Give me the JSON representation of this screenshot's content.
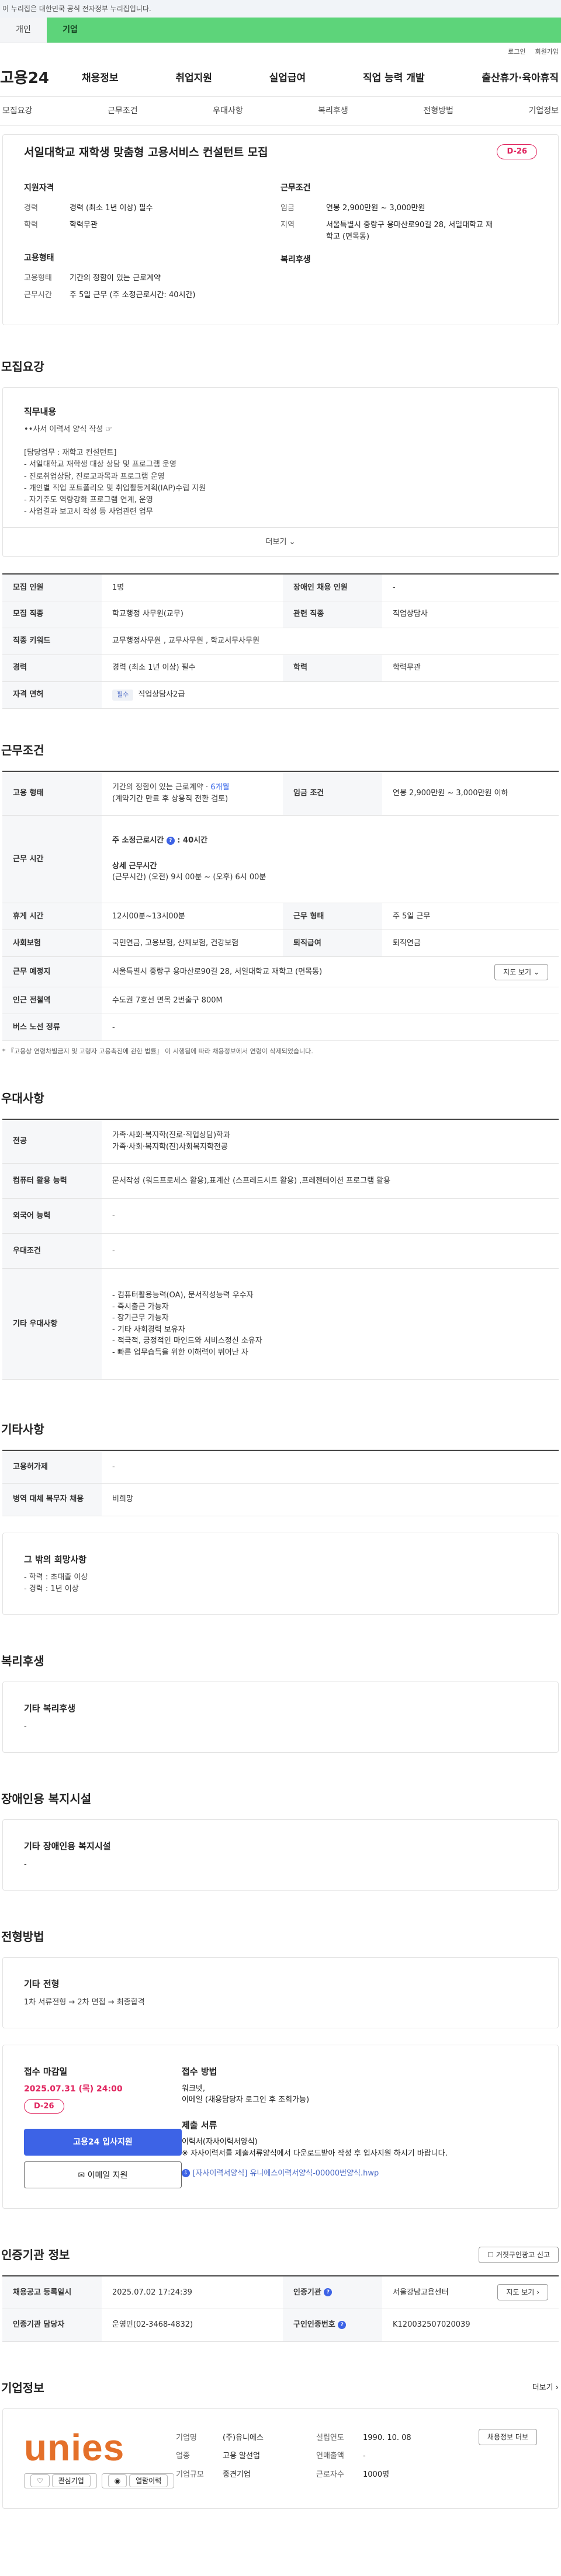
{
  "gov_banner": "이 누리집은 대한민국 공식 전자정부 누리집입니다.",
  "tabs": [
    "개인",
    "기업"
  ],
  "util": [
    "로그인",
    "회원가입"
  ],
  "logo": "고용24",
  "gnb": [
    "채용정보",
    "취업지원",
    "실업급여",
    "직업 능력 개발",
    "출산휴가·육아휴직"
  ],
  "anchors": [
    "모집요강",
    "근무조건",
    "우대사항",
    "복리후생",
    "전형방법",
    "기업정보"
  ],
  "title": "서일대학교 재학생 맞춤형 고용서비스 컨설턴트 모집",
  "dday": "D-26",
  "summary": {
    "qual_h": "지원자격",
    "career_k": "경력",
    "career_v": "경력 (최소 1년 이상) 필수",
    "edu_k": "학력",
    "edu_v": "학력무관",
    "cond_h": "근무조건",
    "wage_k": "임금",
    "wage_v": "연봉 2,900만원 ~ 3,000만원",
    "area_k": "지역",
    "area_v": "서울특별시 중랑구 용마산로90길 28, 서일대학교 재학고 (면목동)",
    "emp_h": "고용형태",
    "type_k": "고용형태",
    "type_v": "기간의 정함이 있는 근로계약",
    "hours_k": "근무시간",
    "hours_v": "주 5일 근무 (주 소정근로시간: 40시간)",
    "welfare_h": "복리후생"
  },
  "sections": {
    "recruit": "모집요강",
    "conditions": "근무조건",
    "preference": "우대사항",
    "etc": "기타사항",
    "welfare": "복리후생",
    "disability": "장애인용 복지시설",
    "process": "전형방법",
    "agency": "인증기관 정보",
    "company": "기업정보"
  },
  "duty": {
    "h": "직무내용",
    "body": "••사서 이력서 양식 작성 ☞\n\n[담당업무 : 재학고 컨설턴트]\n- 서일대학교 재학생 대상 상담 및 프로그램 운영\n- 진로취업상담, 진로교과목과 프로그램 운영\n- 개인별 직업 포트폴리오 및 취업활동계획(IAP)수립 지원\n- 자기주도 역량강화 프로그램 연계, 운영\n- 사업결과 보고서 작성 등 사업관련 업무",
    "more": "더보기"
  },
  "recruit_table": {
    "r1": [
      "모집 인원",
      "1명",
      "장애인 채용 인원",
      "-"
    ],
    "r2": [
      "모집 직종",
      "학교행정 사무원(교무)",
      "관련 직종",
      "직업상담사"
    ],
    "r3": [
      "직종 키워드",
      "교무행정사무원 , 교무사무원 , 학교서무사무원"
    ],
    "r4": [
      "경력",
      "경력 (최소 1년 이상) 필수",
      "학력",
      "학력무관"
    ],
    "r5": [
      "자격 면허",
      "필수",
      "직업상담사2급"
    ]
  },
  "cond_table": {
    "type_k": "고용 형태",
    "type_v1": "기간의 정함이 있는 근로계약 · ",
    "type_link": "6개월",
    "type_v2": "(계약기간 만료 후 상용직 전환 검토)",
    "wage_k": "임금 조건",
    "wage_v": "연봉 2,900만원 ~ 3,000만원 이하",
    "hours_k": "근무 시간",
    "hours_h1": "주 소정근로시간",
    "hours_v1": "40시간",
    "hours_h2": "상세 근무시간",
    "hours_v2": "(근무시간) (오전) 9시 00분 ~ (오후) 6시 00분",
    "break_k": "휴게 시간",
    "break_v": "12시00분~13시00분",
    "form_k": "근무 형태",
    "form_v": "주 5일 근무",
    "ins_k": "사회보험",
    "ins_v": "국민연금, 고용보험, 산재보험, 건강보험",
    "ret_k": "퇴직급여",
    "ret_v": "퇴직연금",
    "addr_k": "근무 예정지",
    "addr_v": "서울특별시 중랑구 용마산로90길 28, 서일대학교 재학고 (면목동)",
    "map": "지도 보기",
    "sub_k": "인근 전철역",
    "sub_v": "수도권 7호선 면목 2번출구 800M",
    "bus_k": "버스 노선 정류",
    "bus_v": "-",
    "note": "* 『고용상 연령차별금지 및 고령자 고용촉진에 관한 법률』 이 시행됨에 따라 채용정보에서 연령이 삭제되었습니다."
  },
  "pref_table": {
    "major_k": "전공",
    "major_v1": "가족·사회·복지학(진로·직업상담)학과",
    "major_v2": "가족·사회·복지학(진)사회복지학전공",
    "pc_k": "컴퓨터 활용 능력",
    "pc_v": "문서작성 (워드프로세스 활용),표계산 (스프레드시트 활용) ,프레젠테이션 프로그램 활용",
    "lang_k": "외국어 능력",
    "lang_v": "-",
    "pref_k": "우대조건",
    "pref_v": "-",
    "etc_k": "기타 우대사항",
    "etc_items": [
      "- 컴퓨터활용능력(OA), 문서작성능력 우수자",
      "- 즉시출근 가능자",
      "- 장기근무 가능자",
      "- 기타 사회경력 보유자",
      "- 적극적, 긍정적인 마인드와 서비스정신 소유자",
      "- 빠른 업무습득을 위한 이해력이 뛰어난 자"
    ]
  },
  "etc_table": {
    "cost_k": "고용허가제",
    "cost_v": "-",
    "cert_k": "병역 대체 복무자 채용",
    "cert_v": "비희망"
  },
  "other_pref": {
    "h": "그 밖의 희망사항",
    "items": [
      "- 학력 : 초대졸 이상",
      "- 경력 : 1년 이상"
    ]
  },
  "welfare_box": {
    "h": "기타 복리후생",
    "t": "-"
  },
  "disab_box": {
    "h": "기타 장애인용 복지시설",
    "t": "-"
  },
  "process_box": {
    "h": "기타 전형",
    "t": "1차 서류전형 → 2차 면접 → 최종합격"
  },
  "apply": {
    "dl_h": "접수 마감일",
    "dl_v": "2025.07.31 (목) 24:00",
    "dday": "D-26",
    "primary": "고용24 입사지원",
    "secondary": "이메일 지원",
    "method_h": "접수 방법",
    "method_v1": "워크넷,",
    "method_v2": "이메일 (채용담당자 로그인 후 조회가능)",
    "docs_h": "제출 서류",
    "docs_v1": "이력서(자사이력서양식)",
    "docs_v2": "※ 자사이력서를 제출서류양식에서 다운로드받아 작성 후 입사지원 하시기 바랍니다.",
    "file": "[자사이력서양식] 유니에스이력서양식-00000번양식.hwp"
  },
  "agency": {
    "report": "거짓구인광고 신고",
    "r1": [
      "채용공고 등록일시",
      "2025.07.02 17:24:39",
      "인증기관",
      "서울강남고용센터"
    ],
    "map": "지도 보기",
    "r2": [
      "인증기관 담당자",
      "운영민(02-3468-4832)",
      "구인인증번호",
      "K120032507020039"
    ]
  },
  "company": {
    "more": "더보기",
    "logo_text": "unies",
    "fav": "관심기업",
    "rec": "열람이력",
    "name_k": "기업명",
    "name_v": "(주)유니에스",
    "est_k": "설립연도",
    "est_v": "1990. 10. 08",
    "btn": "채용정보 더보",
    "ind_k": "업종",
    "ind_v": "고용 알선업",
    "rev_k": "연매출액",
    "rev_v": "-",
    "size_k": "기업규모",
    "size_v": "중견기업",
    "emp_k": "근로자수",
    "emp_v": "1000명"
  }
}
